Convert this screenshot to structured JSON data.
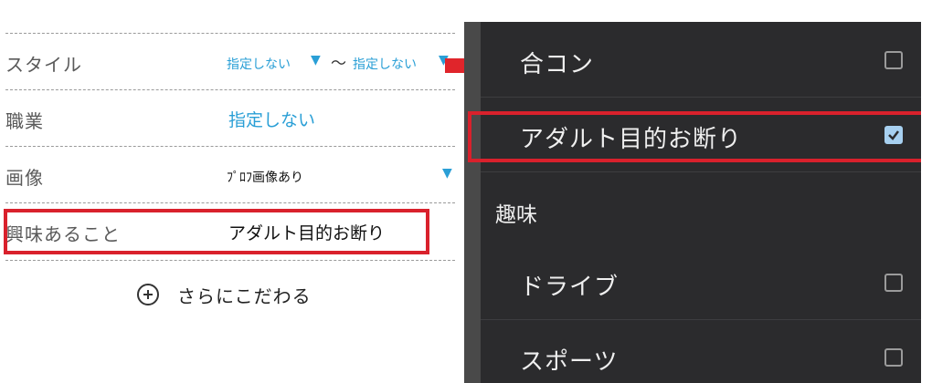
{
  "form": {
    "rows": [
      {
        "label": "スタイル",
        "value_from": "指定しない",
        "tilde": "〜",
        "value_to": "指定しない"
      },
      {
        "label": "職業",
        "value": "指定しない"
      },
      {
        "label": "画像",
        "value": "ﾌﾟﾛﾌ画像あり"
      },
      {
        "label": "興味あること",
        "value": "アダルト目的お断り"
      }
    ],
    "more_label": "さらにこだわる"
  },
  "panel": {
    "items": [
      {
        "label": "合コン",
        "checked": false
      },
      {
        "label": "アダルト目的お断り",
        "checked": true
      }
    ],
    "section_title": "趣味",
    "items2": [
      {
        "label": "ドライブ",
        "checked": false
      },
      {
        "label": "スポーツ",
        "checked": false
      }
    ]
  },
  "colors": {
    "accent": "#2a9fd6",
    "highlight": "#d9212c",
    "panel_bg": "#2b2b2d"
  }
}
